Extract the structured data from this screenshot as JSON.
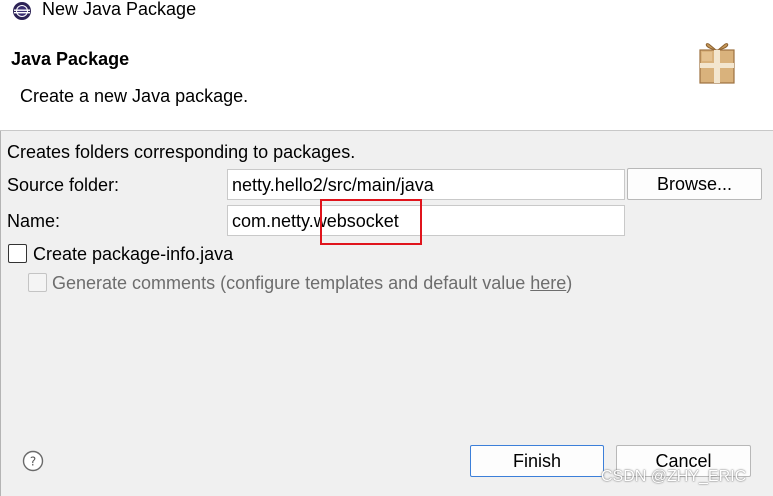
{
  "window": {
    "title": "New Java Package",
    "icon": "eclipse-icon"
  },
  "banner": {
    "title": "Java Package",
    "description": "Create a new Java package.",
    "icon": "package-icon"
  },
  "form": {
    "intro": "Creates folders corresponding to packages.",
    "source_folder": {
      "label": "Source folder:",
      "value": "netty.hello2/src/main/java",
      "browse_label": "Browse..."
    },
    "name": {
      "label": "Name:",
      "value": "com.netty.websocket"
    },
    "create_package_info": {
      "label": "Create package-info.java",
      "checked": false
    },
    "generate_comments": {
      "label_prefix": "Generate comments (configure templates and default value ",
      "link": "here",
      "label_suffix": ")",
      "checked": false,
      "enabled": false
    }
  },
  "footer": {
    "help_icon": "help-icon",
    "finish_label": "Finish",
    "cancel_label": "Cancel"
  },
  "annotation": {
    "highlight_color": "#e0141c"
  },
  "watermark": "CSDN @ZHY_ERIC"
}
